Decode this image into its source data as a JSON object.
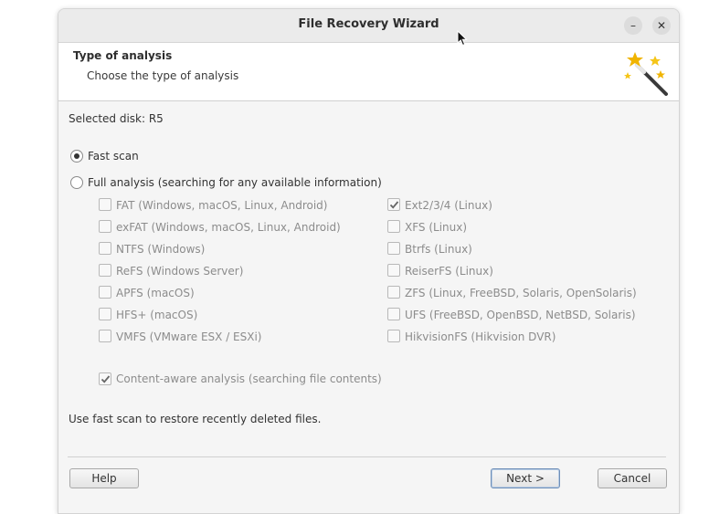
{
  "window": {
    "title": "File Recovery Wizard",
    "minimize_glyph": "–",
    "close_glyph": "✕"
  },
  "header": {
    "title": "Type of analysis",
    "subtitle": "Choose the type of analysis",
    "icon": "magic-wand-icon"
  },
  "selected_disk": "Selected disk: R5",
  "options": {
    "fast_scan": {
      "label": "Fast scan",
      "checked": true
    },
    "full_analysis": {
      "label": "Full analysis (searching for any available information)",
      "checked": false
    }
  },
  "filesystems_left": [
    {
      "label": "FAT (Windows, macOS, Linux, Android)",
      "checked": false
    },
    {
      "label": "exFAT (Windows, macOS, Linux, Android)",
      "checked": false
    },
    {
      "label": "NTFS (Windows)",
      "checked": false
    },
    {
      "label": "ReFS (Windows Server)",
      "checked": false
    },
    {
      "label": "APFS (macOS)",
      "checked": false
    },
    {
      "label": "HFS+ (macOS)",
      "checked": false
    },
    {
      "label": "VMFS (VMware ESX / ESXi)",
      "checked": false
    }
  ],
  "filesystems_right": [
    {
      "label": "Ext2/3/4 (Linux)",
      "checked": true
    },
    {
      "label": "XFS (Linux)",
      "checked": false
    },
    {
      "label": "Btrfs (Linux)",
      "checked": false
    },
    {
      "label": "ReiserFS (Linux)",
      "checked": false
    },
    {
      "label": "ZFS (Linux, FreeBSD, Solaris, OpenSolaris)",
      "checked": false
    },
    {
      "label": "UFS (FreeBSD, OpenBSD, NetBSD, Solaris)",
      "checked": false
    },
    {
      "label": "HikvisionFS (Hikvision DVR)",
      "checked": false
    }
  ],
  "content_aware": {
    "label": "Content-aware analysis (searching file contents)",
    "checked": true
  },
  "hint": "Use fast scan to restore recently deleted files.",
  "buttons": {
    "help": "Help",
    "next": "Next >",
    "cancel": "Cancel"
  }
}
